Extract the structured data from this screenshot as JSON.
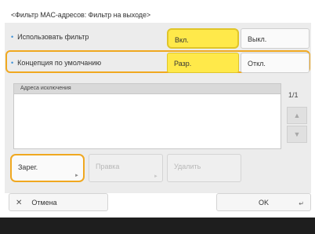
{
  "screen": {
    "title": "<Фильтр MAC-адресов: Фильтр на выходе>"
  },
  "settings": [
    {
      "label": "Использовать фильтр",
      "options": [
        "Вкл.",
        "Выкл."
      ],
      "selected": "Вкл."
    },
    {
      "label": "Концепция по умолчанию",
      "options": [
        "Разр.",
        "Откл."
      ],
      "selected": "Разр."
    }
  ],
  "exception_list": {
    "header": "Адреса исключения",
    "page_indicator": "1/1",
    "items": []
  },
  "actions": {
    "register": "Зарег.",
    "edit": "Правка",
    "delete": "Удалить"
  },
  "footer": {
    "cancel": "Отмена",
    "ok": "OK"
  },
  "colors": {
    "highlight": "#ffe94a",
    "focus_frame": "#f0a820",
    "bullet": "#3a8fd6"
  }
}
